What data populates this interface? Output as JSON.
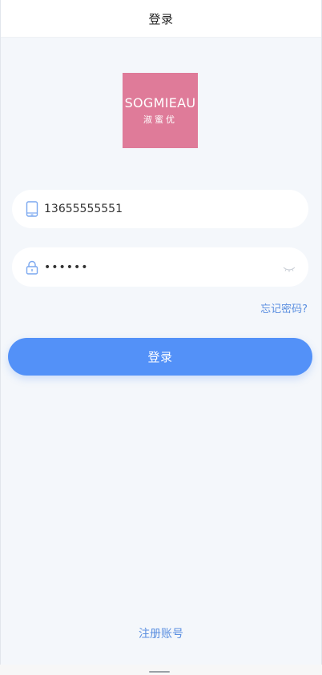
{
  "nav": {
    "title": "登录"
  },
  "logo": {
    "brand": "SOGMIEAU",
    "sub": "淑蜜优",
    "bg": "#df7b99"
  },
  "phone_field": {
    "value": "13655555551",
    "icon": "phone-icon"
  },
  "password_field": {
    "value": "••••••",
    "icon": "lock-icon",
    "toggle_icon": "eye-closed-icon"
  },
  "links": {
    "forgot": "忘记密码?",
    "register": "注册账号"
  },
  "login_button": {
    "label": "登录",
    "color": "#5391f8"
  },
  "colors": {
    "link": "#5b8fe0",
    "background": "#f4f7fb"
  }
}
